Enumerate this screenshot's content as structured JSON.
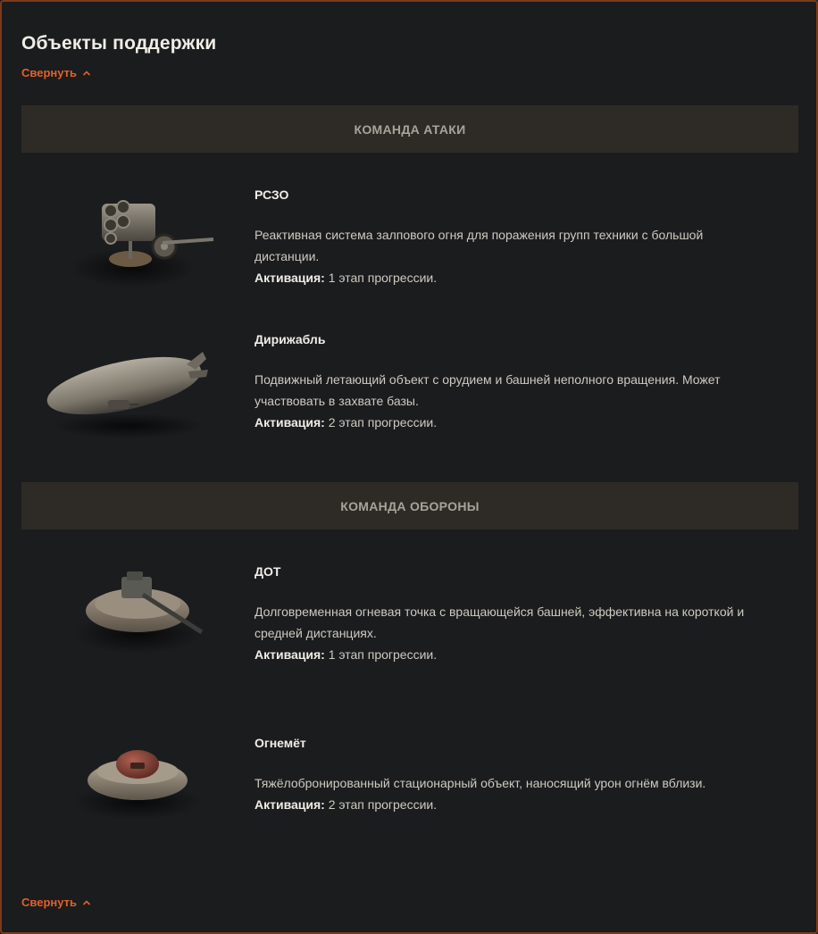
{
  "title": "Объекты поддержки",
  "collapse_label": "Свернуть",
  "sections": [
    {
      "header": "КОМАНДА АТАКИ",
      "items": [
        {
          "name": "РСЗО",
          "description": "Реактивная система залпового огня для поражения групп техники с большой дистанции.",
          "activation_label": "Активация:",
          "activation_value": "1 этап прогрессии.",
          "image": "rszo-icon"
        },
        {
          "name": "Дирижабль",
          "description": "Подвижный летающий объект с орудием и башней неполного вращения. Может участвовать в захвате базы.",
          "activation_label": "Активация:",
          "activation_value": "2 этап прогрессии.",
          "image": "airship-icon"
        }
      ]
    },
    {
      "header": "КОМАНДА ОБОРОНЫ",
      "items": [
        {
          "name": "ДОТ",
          "description": "Долговременная огневая точка с вращающейся башней, эффективна на короткой и средней дистанциях.",
          "activation_label": "Активация:",
          "activation_value": "1 этап прогрессии.",
          "image": "bunker-icon"
        },
        {
          "name": "Огнемёт",
          "description": "Тяжёлобронированный стационарный объект, наносящий урон огнём вблизи.",
          "activation_label": "Активация:",
          "activation_value": "2 этап прогрессии.",
          "image": "flamethrower-icon"
        }
      ]
    }
  ],
  "colors": {
    "background": "#1b1c1e",
    "accent": "#e0612a",
    "section_bar": "#2e2b27",
    "border": "#7a3b1a"
  }
}
